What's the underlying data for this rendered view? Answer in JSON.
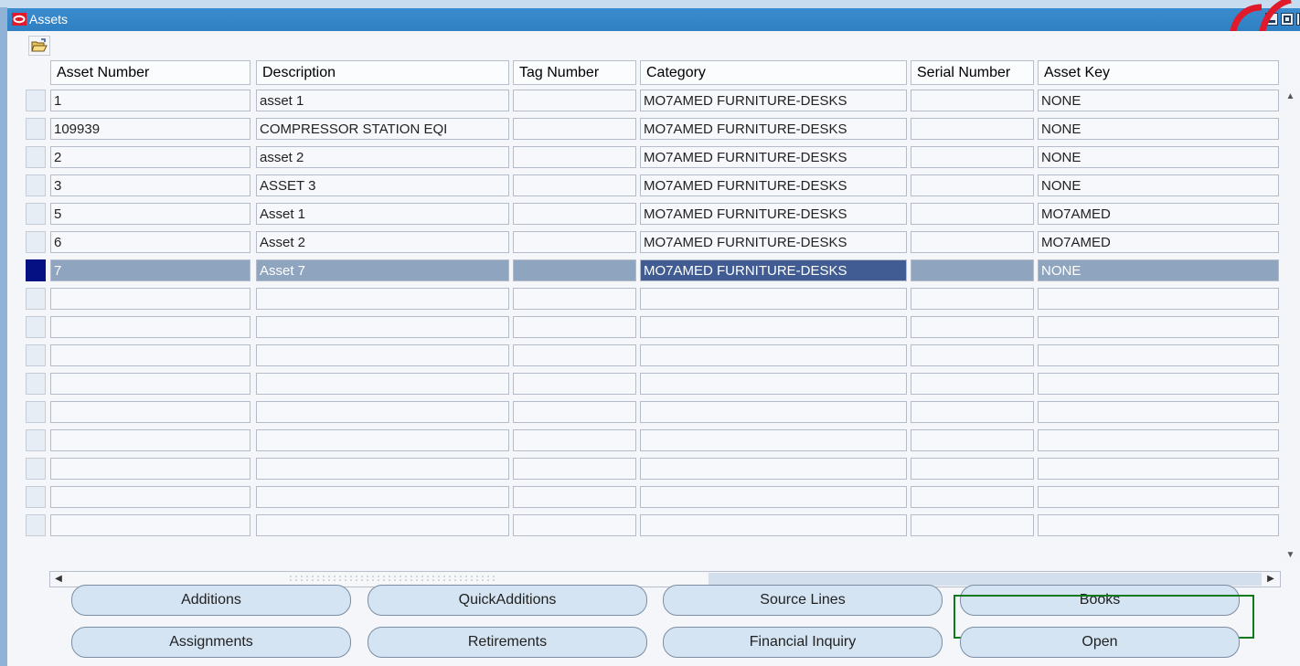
{
  "window": {
    "title": "Assets"
  },
  "columns": [
    "Asset Number",
    "Description",
    "Tag Number",
    "Category",
    "Serial Number",
    "Asset Key"
  ],
  "rows": [
    {
      "asset_number": "1",
      "description": "asset 1",
      "tag_number": "",
      "category": "MO7AMED FURNITURE-DESKS",
      "serial_number": "",
      "asset_key": "NONE"
    },
    {
      "asset_number": "109939",
      "description": "COMPRESSOR STATION EQI",
      "tag_number": "",
      "category": "MO7AMED FURNITURE-DESKS",
      "serial_number": "",
      "asset_key": "NONE"
    },
    {
      "asset_number": "2",
      "description": "asset 2",
      "tag_number": "",
      "category": "MO7AMED FURNITURE-DESKS",
      "serial_number": "",
      "asset_key": "NONE"
    },
    {
      "asset_number": "3",
      "description": "ASSET 3",
      "tag_number": "",
      "category": "MO7AMED FURNITURE-DESKS",
      "serial_number": "",
      "asset_key": "NONE"
    },
    {
      "asset_number": "5",
      "description": "Asset 1",
      "tag_number": "",
      "category": "MO7AMED FURNITURE-DESKS",
      "serial_number": "",
      "asset_key": "MO7AMED"
    },
    {
      "asset_number": "6",
      "description": "Asset 2",
      "tag_number": "",
      "category": "MO7AMED FURNITURE-DESKS",
      "serial_number": "",
      "asset_key": "MO7AMED"
    },
    {
      "asset_number": "7",
      "description": "Asset 7",
      "tag_number": "",
      "category": "MO7AMED FURNITURE-DESKS",
      "serial_number": "",
      "asset_key": "NONE"
    },
    {
      "asset_number": "",
      "description": "",
      "tag_number": "",
      "category": "",
      "serial_number": "",
      "asset_key": ""
    },
    {
      "asset_number": "",
      "description": "",
      "tag_number": "",
      "category": "",
      "serial_number": "",
      "asset_key": ""
    },
    {
      "asset_number": "",
      "description": "",
      "tag_number": "",
      "category": "",
      "serial_number": "",
      "asset_key": ""
    },
    {
      "asset_number": "",
      "description": "",
      "tag_number": "",
      "category": "",
      "serial_number": "",
      "asset_key": ""
    },
    {
      "asset_number": "",
      "description": "",
      "tag_number": "",
      "category": "",
      "serial_number": "",
      "asset_key": ""
    },
    {
      "asset_number": "",
      "description": "",
      "tag_number": "",
      "category": "",
      "serial_number": "",
      "asset_key": ""
    },
    {
      "asset_number": "",
      "description": "",
      "tag_number": "",
      "category": "",
      "serial_number": "",
      "asset_key": ""
    },
    {
      "asset_number": "",
      "description": "",
      "tag_number": "",
      "category": "",
      "serial_number": "",
      "asset_key": ""
    },
    {
      "asset_number": "",
      "description": "",
      "tag_number": "",
      "category": "",
      "serial_number": "",
      "asset_key": ""
    }
  ],
  "selected_row": 7,
  "buttons": {
    "additions": "Additions",
    "quick_additions": "QuickAdditions",
    "source_lines": "Source Lines",
    "books": "Books",
    "assignments": "Assignments",
    "retirements": "Retirements",
    "financial_inquiry": "Financial Inquiry",
    "open": "Open"
  },
  "focused_button": "open",
  "icons": {
    "app_logo": "oracle-logo-icon",
    "toolbar": "open-folder-icon",
    "scroll_up": "arrow-up-icon",
    "scroll_down": "arrow-down-icon",
    "scroll_left": "arrow-left-icon",
    "scroll_right": "arrow-right-icon"
  },
  "colors": {
    "titlebar": "#2f7fc3",
    "selected_row": "#8fa4be",
    "selected_cell": "#405c93",
    "record_indicator": "#051182",
    "button_fill": "#d4e4f3",
    "focus_ring": "#0f7a1b",
    "brand_red": "#e01a2b"
  }
}
